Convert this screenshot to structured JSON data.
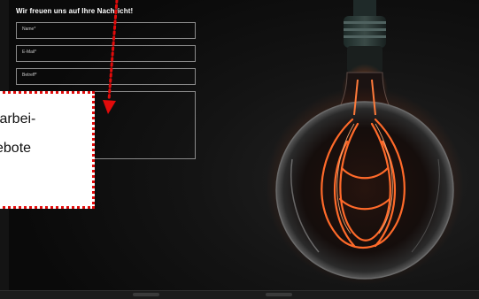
{
  "form": {
    "title": "Wir freuen uns auf Ihre Nachricht!",
    "fields": [
      {
        "placeholder": "Name*"
      },
      {
        "placeholder": "E-Mail*"
      },
      {
        "placeholder": "Betreff*"
      },
      {
        "placeholder": ""
      }
    ]
  },
  "callout": {
    "lines": [
      "tarbei-",
      "ebote"
    ],
    "border_color": "#e10b0b"
  },
  "colors": {
    "background": "#0f0f0f",
    "bulb_glow": "#ff6a2a",
    "field_border": "#8a8a8a"
  }
}
